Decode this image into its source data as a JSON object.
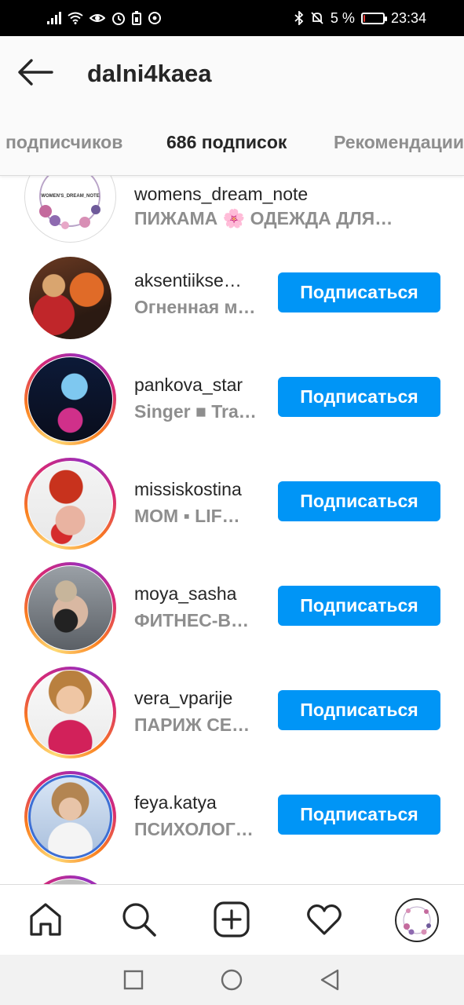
{
  "status_bar": {
    "battery_percent": "5 %",
    "time": "23:34",
    "battery_level": 0.08,
    "battery_color": "#e53935"
  },
  "header": {
    "title": "dalni4kaea",
    "back_icon": "arrow-left-icon"
  },
  "tabs": [
    {
      "label": "подписчиков",
      "active": false
    },
    {
      "label": "686 подписок",
      "active": true
    },
    {
      "label": "Рекомендации",
      "active": false
    }
  ],
  "follow_label": "Подписаться",
  "accent_color": "#0095f6",
  "accounts": [
    {
      "username": "womens_dream_note",
      "bio": "ПИЖАМА 🌸 ОДЕЖДА ДЛЯ…",
      "logo_text": "WOMEN'S_DREAM_NOTE",
      "has_story": false,
      "show_button": false
    },
    {
      "username": "aksentiikse…",
      "bio": "Огненная м…",
      "has_story": false,
      "show_button": true
    },
    {
      "username": "pankova_star",
      "bio": "Singer ■ Tra…",
      "has_story": true,
      "show_button": true
    },
    {
      "username": "missiskostina",
      "bio": "MOM ▪ LIF…",
      "has_story": true,
      "show_button": true
    },
    {
      "username": "moya_sasha",
      "bio": "ФИТНЕС-В…",
      "has_story": true,
      "show_button": true
    },
    {
      "username": "vera_vparije",
      "bio": "ПАРИЖ СЕ…",
      "has_story": true,
      "show_button": true
    },
    {
      "username": "feya.katya",
      "bio": "ПСИХОЛОГ…",
      "has_story": true,
      "show_button": true
    }
  ],
  "bottom_nav": [
    {
      "icon": "home-icon"
    },
    {
      "icon": "search-icon"
    },
    {
      "icon": "add-post-icon"
    },
    {
      "icon": "heart-icon"
    },
    {
      "icon": "profile-avatar"
    }
  ],
  "system_nav": [
    {
      "icon": "recent-apps-icon"
    },
    {
      "icon": "home-circle-icon"
    },
    {
      "icon": "back-triangle-icon"
    }
  ]
}
